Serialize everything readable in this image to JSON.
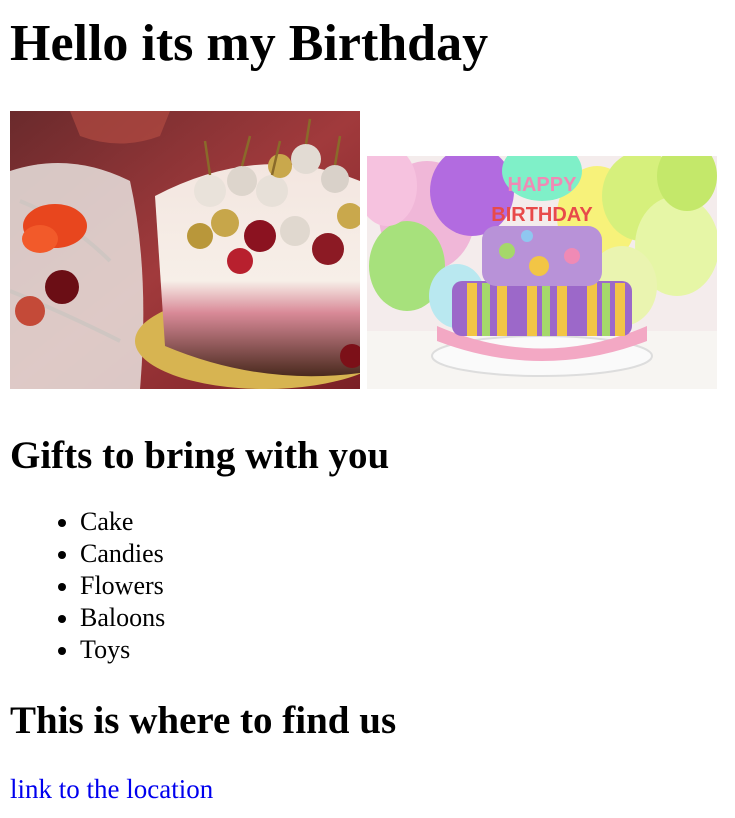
{
  "page_title": "Hello its my Birthday",
  "images": [
    {
      "icon": "cake-with-cherries-photo"
    },
    {
      "icon": "birthday-cake-balloons-photo",
      "candles_text": [
        "HAPPY",
        "BIRTHDAY"
      ]
    }
  ],
  "gifts": {
    "heading": "Gifts to bring with you",
    "items": [
      "Cake",
      "Candies",
      "Flowers",
      "Baloons",
      "Toys"
    ]
  },
  "location": {
    "heading": "This is where to find us",
    "link_label": "link to the location",
    "link_color": "#0000ee"
  }
}
